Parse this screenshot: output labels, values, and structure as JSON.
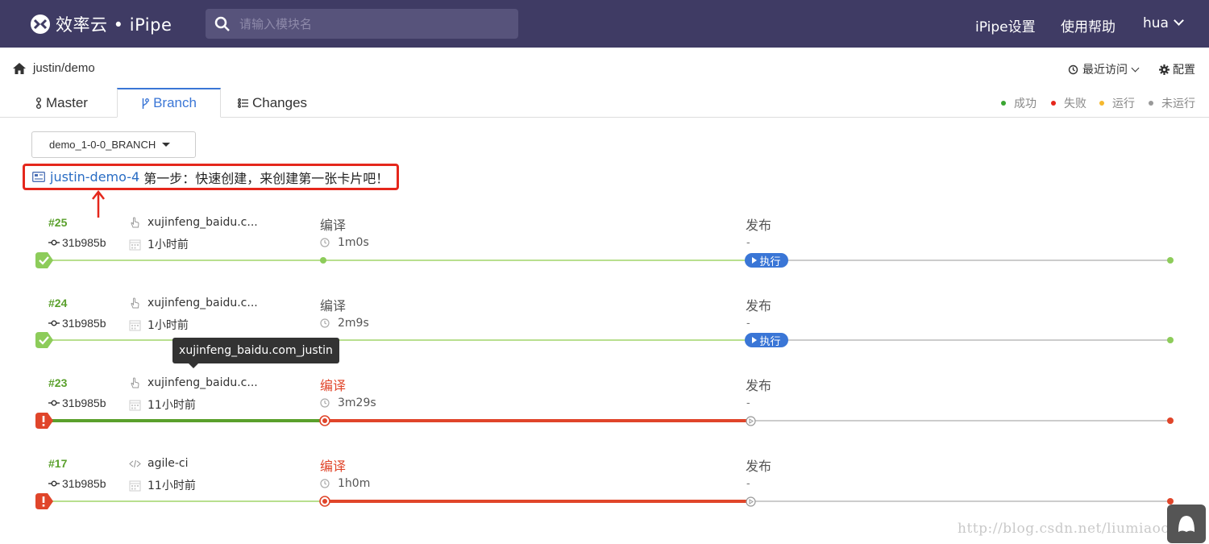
{
  "header": {
    "logo_text": "效率云 • iPipe",
    "search_placeholder": "请输入模块名",
    "nav": {
      "settings": "iPipe设置",
      "help": "使用帮助",
      "user": "hua"
    }
  },
  "breadcrumb": {
    "path": "justin/demo",
    "recent": "最近访问",
    "config": "配置"
  },
  "tabs": [
    {
      "label": "Master",
      "icon": "pipeline-icon"
    },
    {
      "label": "Branch",
      "icon": "branch-icon",
      "active": true
    },
    {
      "label": "Changes",
      "icon": "list-icon"
    }
  ],
  "legend": [
    {
      "label": "成功",
      "color": "#3aa632"
    },
    {
      "label": "失败",
      "color": "#e5271c"
    },
    {
      "label": "运行",
      "color": "#f5b82e"
    },
    {
      "label": "未运行",
      "color": "#999999"
    }
  ],
  "branch_selector": {
    "value": "demo_1-0-0_BRANCH"
  },
  "card": {
    "id": "justin-demo-4",
    "title": "第一步：快速创建，来创建第一张卡片吧！"
  },
  "stage_labels": {
    "compile": "编译",
    "publish": "发布",
    "execute": "执行",
    "empty": "-"
  },
  "colors": {
    "success": "#9fd46b",
    "success_dark": "#5aa02c",
    "fail": "#e0452a",
    "pending": "#cccccc",
    "primary": "#3a76d6"
  },
  "runs": [
    {
      "id": "#25",
      "commit": "31b985b",
      "user": "xujinfeng_baidu.c...",
      "user_icon": "hand-pointer-icon",
      "time": "1小时前",
      "compile_duration": "1m0s",
      "status": "success"
    },
    {
      "id": "#24",
      "commit": "31b985b",
      "user": "xujinfeng_baidu.c...",
      "user_icon": "hand-pointer-icon",
      "time": "1小时前",
      "compile_duration": "2m9s",
      "status": "success"
    },
    {
      "id": "#23",
      "commit": "31b985b",
      "user": "xujinfeng_baidu.c...",
      "user_icon": "hand-pointer-icon",
      "time": "11小时前",
      "compile_duration": "3m29s",
      "status": "failed"
    },
    {
      "id": "#17",
      "commit": "31b985b",
      "user": "agile-ci",
      "user_icon": "code-icon",
      "time": "11小时前",
      "compile_duration": "1h0m",
      "status": "failed"
    }
  ],
  "tooltip": {
    "text": "xujinfeng_baidu.com_justin"
  },
  "watermark": "http://blog.csdn.net/liumiaocn"
}
